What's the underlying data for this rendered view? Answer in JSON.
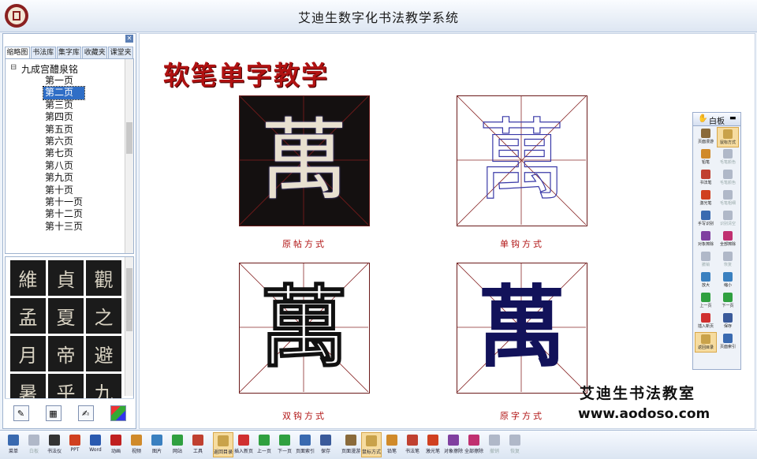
{
  "app": {
    "title": "艾迪生数字化书法教学系统"
  },
  "sidebar": {
    "tabs": [
      "缩略图",
      "书法库",
      "集字库",
      "收藏夹",
      "课堂夹"
    ],
    "active_tab": 0,
    "tree_root": "九成宫醴泉铭",
    "pages": [
      "第一页",
      "第二页",
      "第三页",
      "第四页",
      "第五页",
      "第六页",
      "第七页",
      "第八页",
      "第九页",
      "第十页",
      "第十一页",
      "第十二页",
      "第十三页"
    ],
    "selected_page": 1,
    "thumbnail_chars": [
      "維",
      "貞",
      "觀",
      "孟",
      "夏",
      "之",
      "月",
      "帝",
      "避",
      "暑",
      "乎",
      "九"
    ]
  },
  "main": {
    "heading": "软笔单字教学",
    "character": "萬",
    "panels": [
      {
        "caption": "原帖方式",
        "style": "original-rubbing"
      },
      {
        "caption": "单钩方式",
        "style": "single-outline"
      },
      {
        "caption": "双钩方式",
        "style": "double-outline"
      },
      {
        "caption": "原字方式",
        "style": "solid"
      }
    ]
  },
  "whiteboard": {
    "title": "白板",
    "tools": [
      {
        "label": "页面漫游",
        "icon": "hand-icon",
        "color": "#8a6a3a",
        "enabled": true,
        "active": false
      },
      {
        "label": "鼠标方式",
        "icon": "cursor-icon",
        "color": "#c9a24a",
        "enabled": true,
        "active": true
      },
      {
        "label": "铅笔",
        "icon": "pencil-icon",
        "color": "#d08a2a",
        "enabled": true,
        "active": false
      },
      {
        "label": "毛笔颜色",
        "icon": "color-icon",
        "color": "#b0b8c8",
        "enabled": false,
        "active": false
      },
      {
        "label": "书法笔",
        "icon": "brush-icon",
        "color": "#c04030",
        "enabled": true,
        "active": false
      },
      {
        "label": "毛笔颜色",
        "icon": "color-icon",
        "color": "#b0b8c8",
        "enabled": false,
        "active": false
      },
      {
        "label": "激光笔",
        "icon": "laser-icon",
        "color": "#d04020",
        "enabled": true,
        "active": false
      },
      {
        "label": "毛笔粗细",
        "icon": "size-icon",
        "color": "#b0b8c8",
        "enabled": false,
        "active": false
      },
      {
        "label": "手写识别",
        "icon": "handwriting-icon",
        "color": "#3a6ab0",
        "enabled": true,
        "active": false
      },
      {
        "label": "识别清空",
        "icon": "clear-icon",
        "color": "#b0b8c8",
        "enabled": false,
        "active": false
      },
      {
        "label": "对象擦除",
        "icon": "eraser-icon",
        "color": "#8040a0",
        "enabled": true,
        "active": false
      },
      {
        "label": "全部擦除",
        "icon": "erase-all-icon",
        "color": "#c03070",
        "enabled": true,
        "active": false
      },
      {
        "label": "撤销",
        "icon": "undo-icon",
        "color": "#b0b8c8",
        "enabled": false,
        "active": false
      },
      {
        "label": "恢复",
        "icon": "redo-icon",
        "color": "#b0b8c8",
        "enabled": false,
        "active": false
      },
      {
        "label": "放大",
        "icon": "zoom-in-icon",
        "color": "#3a80c0",
        "enabled": true,
        "active": false
      },
      {
        "label": "缩小",
        "icon": "zoom-out-icon",
        "color": "#3a80c0",
        "enabled": true,
        "active": false
      },
      {
        "label": "上一页",
        "icon": "prev-icon",
        "color": "#30a040",
        "enabled": true,
        "active": false
      },
      {
        "label": "下一页",
        "icon": "next-icon",
        "color": "#30a040",
        "enabled": true,
        "active": false
      },
      {
        "label": "插入新页",
        "icon": "new-page-icon",
        "color": "#d03030",
        "enabled": true,
        "active": false
      },
      {
        "label": "保存",
        "icon": "save-icon",
        "color": "#3a5a9a",
        "enabled": true,
        "active": false
      },
      {
        "label": "返回目录",
        "icon": "catalog-icon",
        "color": "#c9a24a",
        "enabled": true,
        "active": true
      },
      {
        "label": "页面索引",
        "icon": "index-icon",
        "color": "#3a6ab0",
        "enabled": true,
        "active": false
      }
    ]
  },
  "branding": {
    "name": "艾迪生书法教室",
    "website": "www.aodoso.com"
  },
  "toolbar": {
    "items": [
      {
        "label": "菜单",
        "icon": "menu-icon",
        "color": "#3a6ab0",
        "enabled": true,
        "active": false
      },
      {
        "label": "白板",
        "icon": "whiteboard-icon",
        "color": "#b0b8c8",
        "enabled": false,
        "active": false
      },
      {
        "label": "书法仪",
        "icon": "camera-icon",
        "color": "#333333",
        "enabled": true,
        "active": false
      },
      {
        "label": "PPT",
        "icon": "ppt-icon",
        "color": "#d04020",
        "enabled": true,
        "active": false
      },
      {
        "label": "Word",
        "icon": "word-icon",
        "color": "#2a5ab0",
        "enabled": true,
        "active": false
      },
      {
        "label": "动画",
        "icon": "flash-icon",
        "color": "#c02020",
        "enabled": true,
        "active": false
      },
      {
        "label": "视频",
        "icon": "video-icon",
        "color": "#d08a2a",
        "enabled": true,
        "active": false
      },
      {
        "label": "图片",
        "icon": "picture-icon",
        "color": "#3a80c0",
        "enabled": true,
        "active": false
      },
      {
        "label": "网站",
        "icon": "web-icon",
        "color": "#30a040",
        "enabled": true,
        "active": false
      },
      {
        "label": "工具",
        "icon": "tools-icon",
        "color": "#c04030",
        "enabled": true,
        "active": false
      },
      {
        "label": "返回目录",
        "icon": "catalog-icon",
        "color": "#c9a24a",
        "enabled": true,
        "active": true
      },
      {
        "label": "插入新页",
        "icon": "new-page-icon",
        "color": "#d03030",
        "enabled": true,
        "active": false
      },
      {
        "label": "上一页",
        "icon": "prev-icon",
        "color": "#30a040",
        "enabled": true,
        "active": false
      },
      {
        "label": "下一页",
        "icon": "next-icon",
        "color": "#30a040",
        "enabled": true,
        "active": false
      },
      {
        "label": "页面索引",
        "icon": "index-icon",
        "color": "#3a6ab0",
        "enabled": true,
        "active": false
      },
      {
        "label": "保存",
        "icon": "save-icon",
        "color": "#3a5a9a",
        "enabled": true,
        "active": false
      },
      {
        "label": "页面漫游",
        "icon": "hand-icon",
        "color": "#8a6a3a",
        "enabled": true,
        "active": false
      },
      {
        "label": "鼠标方式",
        "icon": "cursor-icon",
        "color": "#c9a24a",
        "enabled": true,
        "active": true
      },
      {
        "label": "铅笔",
        "icon": "pencil-icon",
        "color": "#d08a2a",
        "enabled": true,
        "active": false
      },
      {
        "label": "书法笔",
        "icon": "brush-icon",
        "color": "#c04030",
        "enabled": true,
        "active": false
      },
      {
        "label": "激光笔",
        "icon": "laser-icon",
        "color": "#d04020",
        "enabled": true,
        "active": false
      },
      {
        "label": "对象擦除",
        "icon": "eraser-icon",
        "color": "#8040a0",
        "enabled": true,
        "active": false
      },
      {
        "label": "全部擦除",
        "icon": "erase-all-icon",
        "color": "#c03070",
        "enabled": true,
        "active": false
      },
      {
        "label": "撤销",
        "icon": "undo-icon",
        "color": "#b0b8c8",
        "enabled": false,
        "active": false
      },
      {
        "label": "恢复",
        "icon": "redo-icon",
        "color": "#b0b8c8",
        "enabled": false,
        "active": false
      }
    ]
  }
}
